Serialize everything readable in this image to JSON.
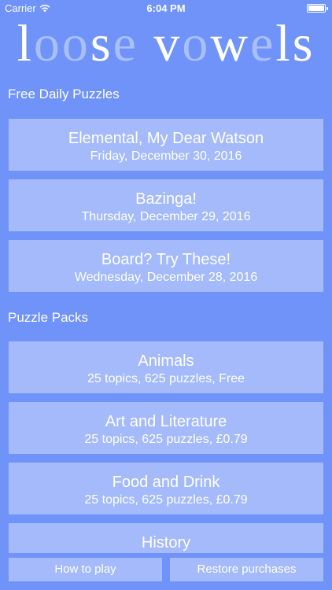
{
  "status_bar": {
    "carrier": "Carrier",
    "time": "6:04 PM"
  },
  "logo": {
    "letters": [
      {
        "char": "l",
        "bright": true
      },
      {
        "char": "o",
        "bright": false
      },
      {
        "char": "o",
        "bright": false
      },
      {
        "char": "s",
        "bright": true
      },
      {
        "char": "e",
        "bright": false
      },
      {
        "char": " ",
        "bright": true
      },
      {
        "char": "v",
        "bright": true
      },
      {
        "char": "o",
        "bright": false
      },
      {
        "char": "w",
        "bright": true
      },
      {
        "char": "e",
        "bright": false
      },
      {
        "char": "l",
        "bright": true
      },
      {
        "char": "s",
        "bright": true
      }
    ]
  },
  "sections": {
    "daily": "Free Daily Puzzles",
    "packs": "Puzzle Packs"
  },
  "daily_puzzles": [
    {
      "title": "Elemental, My Dear Watson",
      "subtitle": "Friday, December 30, 2016"
    },
    {
      "title": "Bazinga!",
      "subtitle": "Thursday, December 29, 2016"
    },
    {
      "title": "Board? Try These!",
      "subtitle": "Wednesday, December 28, 2016"
    }
  ],
  "puzzle_packs": [
    {
      "title": "Animals",
      "subtitle": "25 topics, 625 puzzles, Free"
    },
    {
      "title": "Art and Literature",
      "subtitle": "25 topics, 625 puzzles, £0.79"
    },
    {
      "title": "Food and Drink",
      "subtitle": "25 topics, 625 puzzles, £0.79"
    },
    {
      "title": "History",
      "subtitle": ""
    }
  ],
  "bottom_bar": {
    "how_to_play": "How to play",
    "restore": "Restore purchases"
  },
  "colors": {
    "background": "#6f93f8",
    "card": "#a4bafb",
    "text": "#ffffff",
    "logo_dim": "#a9bff9"
  }
}
